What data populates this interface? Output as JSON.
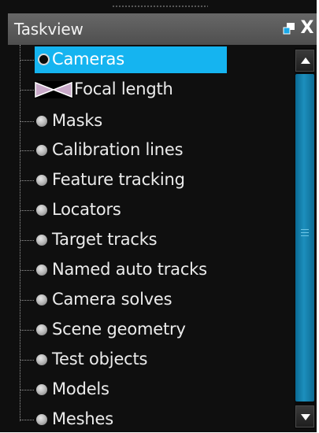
{
  "panel": {
    "title": "Taskview",
    "close_label": "X"
  },
  "tree": {
    "items": [
      {
        "label": "Cameras",
        "selected": true,
        "icon": "camera-bullet-icon"
      },
      {
        "label": "Focal length",
        "icon": "bowtie-icon"
      },
      {
        "label": "Masks",
        "icon": "bullet-icon"
      },
      {
        "label": "Calibration lines",
        "icon": "bullet-icon"
      },
      {
        "label": "Feature tracking",
        "icon": "bullet-icon"
      },
      {
        "label": "Locators",
        "icon": "bullet-icon"
      },
      {
        "label": "Target tracks",
        "icon": "bullet-icon"
      },
      {
        "label": "Named auto tracks",
        "icon": "bullet-icon"
      },
      {
        "label": "Camera solves",
        "icon": "bullet-icon"
      },
      {
        "label": "Scene geometry",
        "icon": "bullet-icon"
      },
      {
        "label": "Test objects",
        "icon": "bullet-icon"
      },
      {
        "label": "Models",
        "icon": "bullet-icon"
      },
      {
        "label": "Meshes",
        "icon": "bullet-icon"
      }
    ]
  },
  "colors": {
    "selection": "#15b4f0",
    "scroll_thumb": "#1c8fbd",
    "background": "#0f0f0f"
  }
}
